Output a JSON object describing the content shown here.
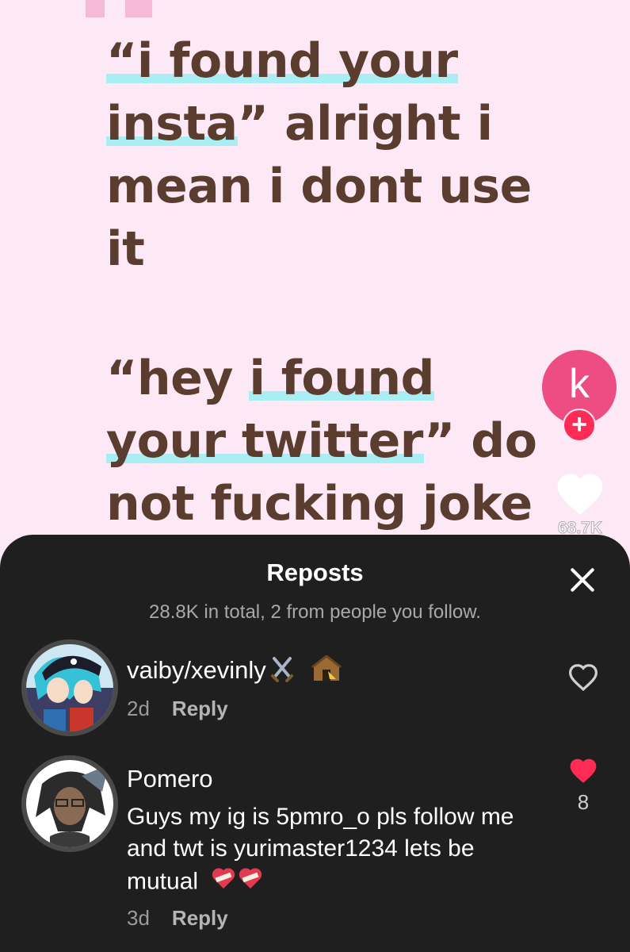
{
  "video": {
    "caption_1": {
      "line1": "“i found your",
      "line2a": "insta",
      "line2b": "” alright i",
      "line3": "mean i dont use",
      "line4": "it"
    },
    "caption_2": {
      "line1a": "“hey ",
      "line1b": "i found",
      "line2a": "your twitter",
      "line2b": "” do",
      "line3": "not fucking joke"
    },
    "colors": {
      "background": "#fde9f6",
      "text": "#5b3d2f",
      "highlight": "#a9eef2"
    }
  },
  "side_actions": {
    "profile_initial": "k",
    "follow_symbol": "+",
    "like_count": "68.7K",
    "profile_color": "#ee4d84"
  },
  "reposts_sheet": {
    "title": "Reposts",
    "subtitle": "28.8K in total, 2 from people you follow.",
    "close_icon": "close-icon",
    "items": [
      {
        "username": "vaiby/xevinly",
        "emoji": "crossed-swords-and-hut",
        "comment": "",
        "time": "2d",
        "reply_label": "Reply",
        "liked": false,
        "like_count": ""
      },
      {
        "username": "Pomero",
        "comment": "Guys my ig is 5pmro_o pls follow me and twt is yurimaster1234 lets be mutual",
        "emoji": "heart-bandaged",
        "time": "3d",
        "reply_label": "Reply",
        "liked": true,
        "like_count": "8"
      }
    ],
    "colors": {
      "sheet": "#1f1f1f",
      "like_red": "#fe2c55"
    }
  }
}
